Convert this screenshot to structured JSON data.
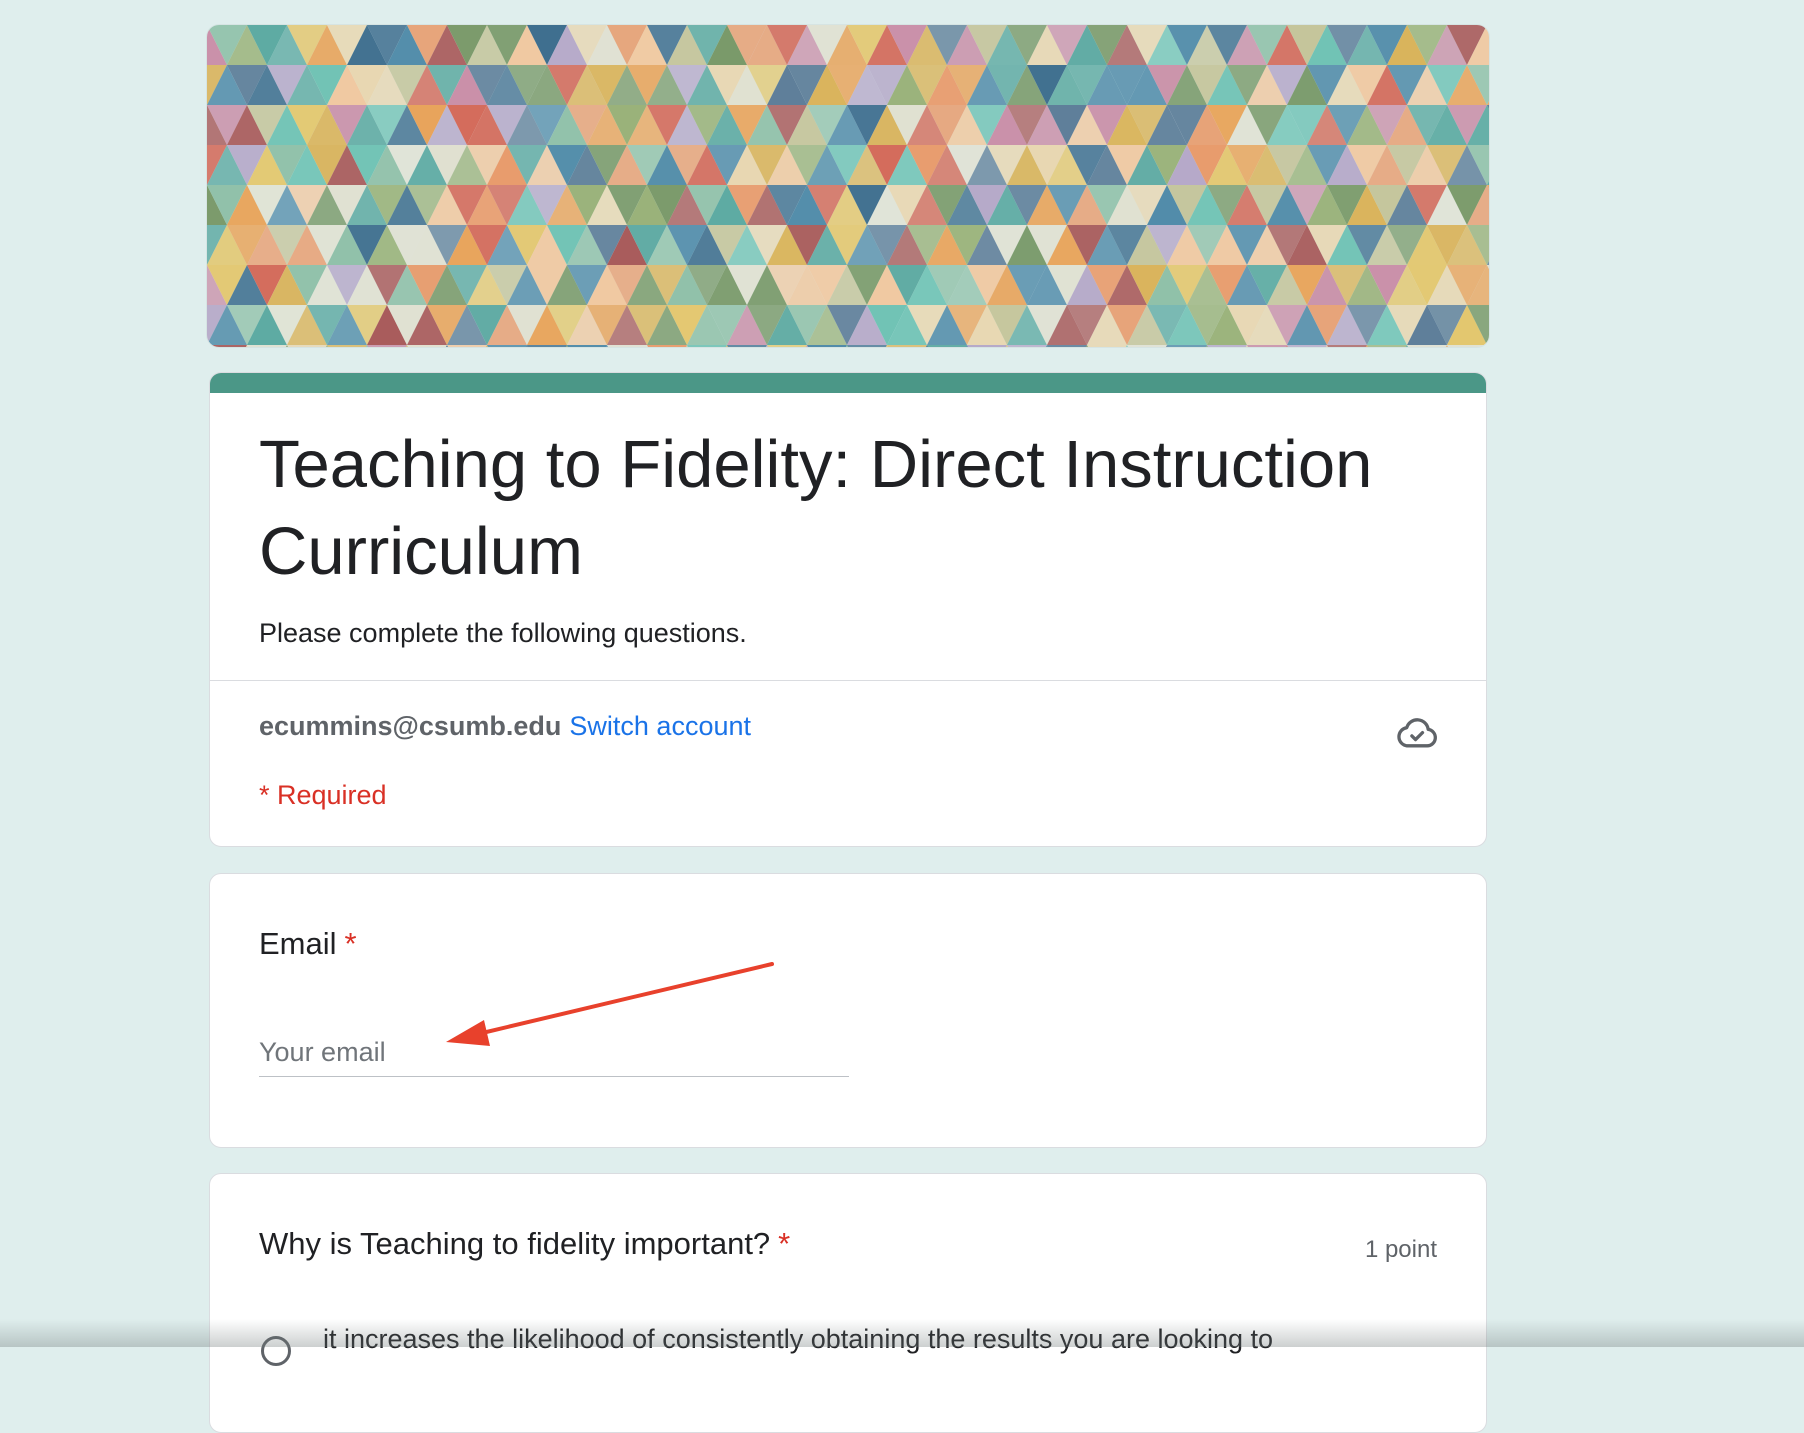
{
  "theme": {
    "accent_color": "#4b9787",
    "background_color": "#dfeeed",
    "required_color": "#d93025",
    "link_color": "#1a73e8"
  },
  "header": {
    "banner_image": "multicolor geometric triangle pattern",
    "title": "Teaching to Fidelity: Direct Instruction Curriculum",
    "description": "Please complete the following questions.",
    "account_email": "ecummins@csumb.edu",
    "switch_account_label": "Switch account",
    "save_status_icon": "cloud-check-icon",
    "required_note": "* Required"
  },
  "questions": [
    {
      "label": "Email",
      "required_marker": "*",
      "placeholder": "Your email",
      "value": ""
    },
    {
      "label": "Why is Teaching to fidelity important?",
      "required_marker": "*",
      "points": "1 point",
      "options": [
        "it increases the likelihood of consistently obtaining the results you are looking to"
      ]
    }
  ],
  "annotation": {
    "type": "arrow",
    "color": "#e8412c"
  }
}
